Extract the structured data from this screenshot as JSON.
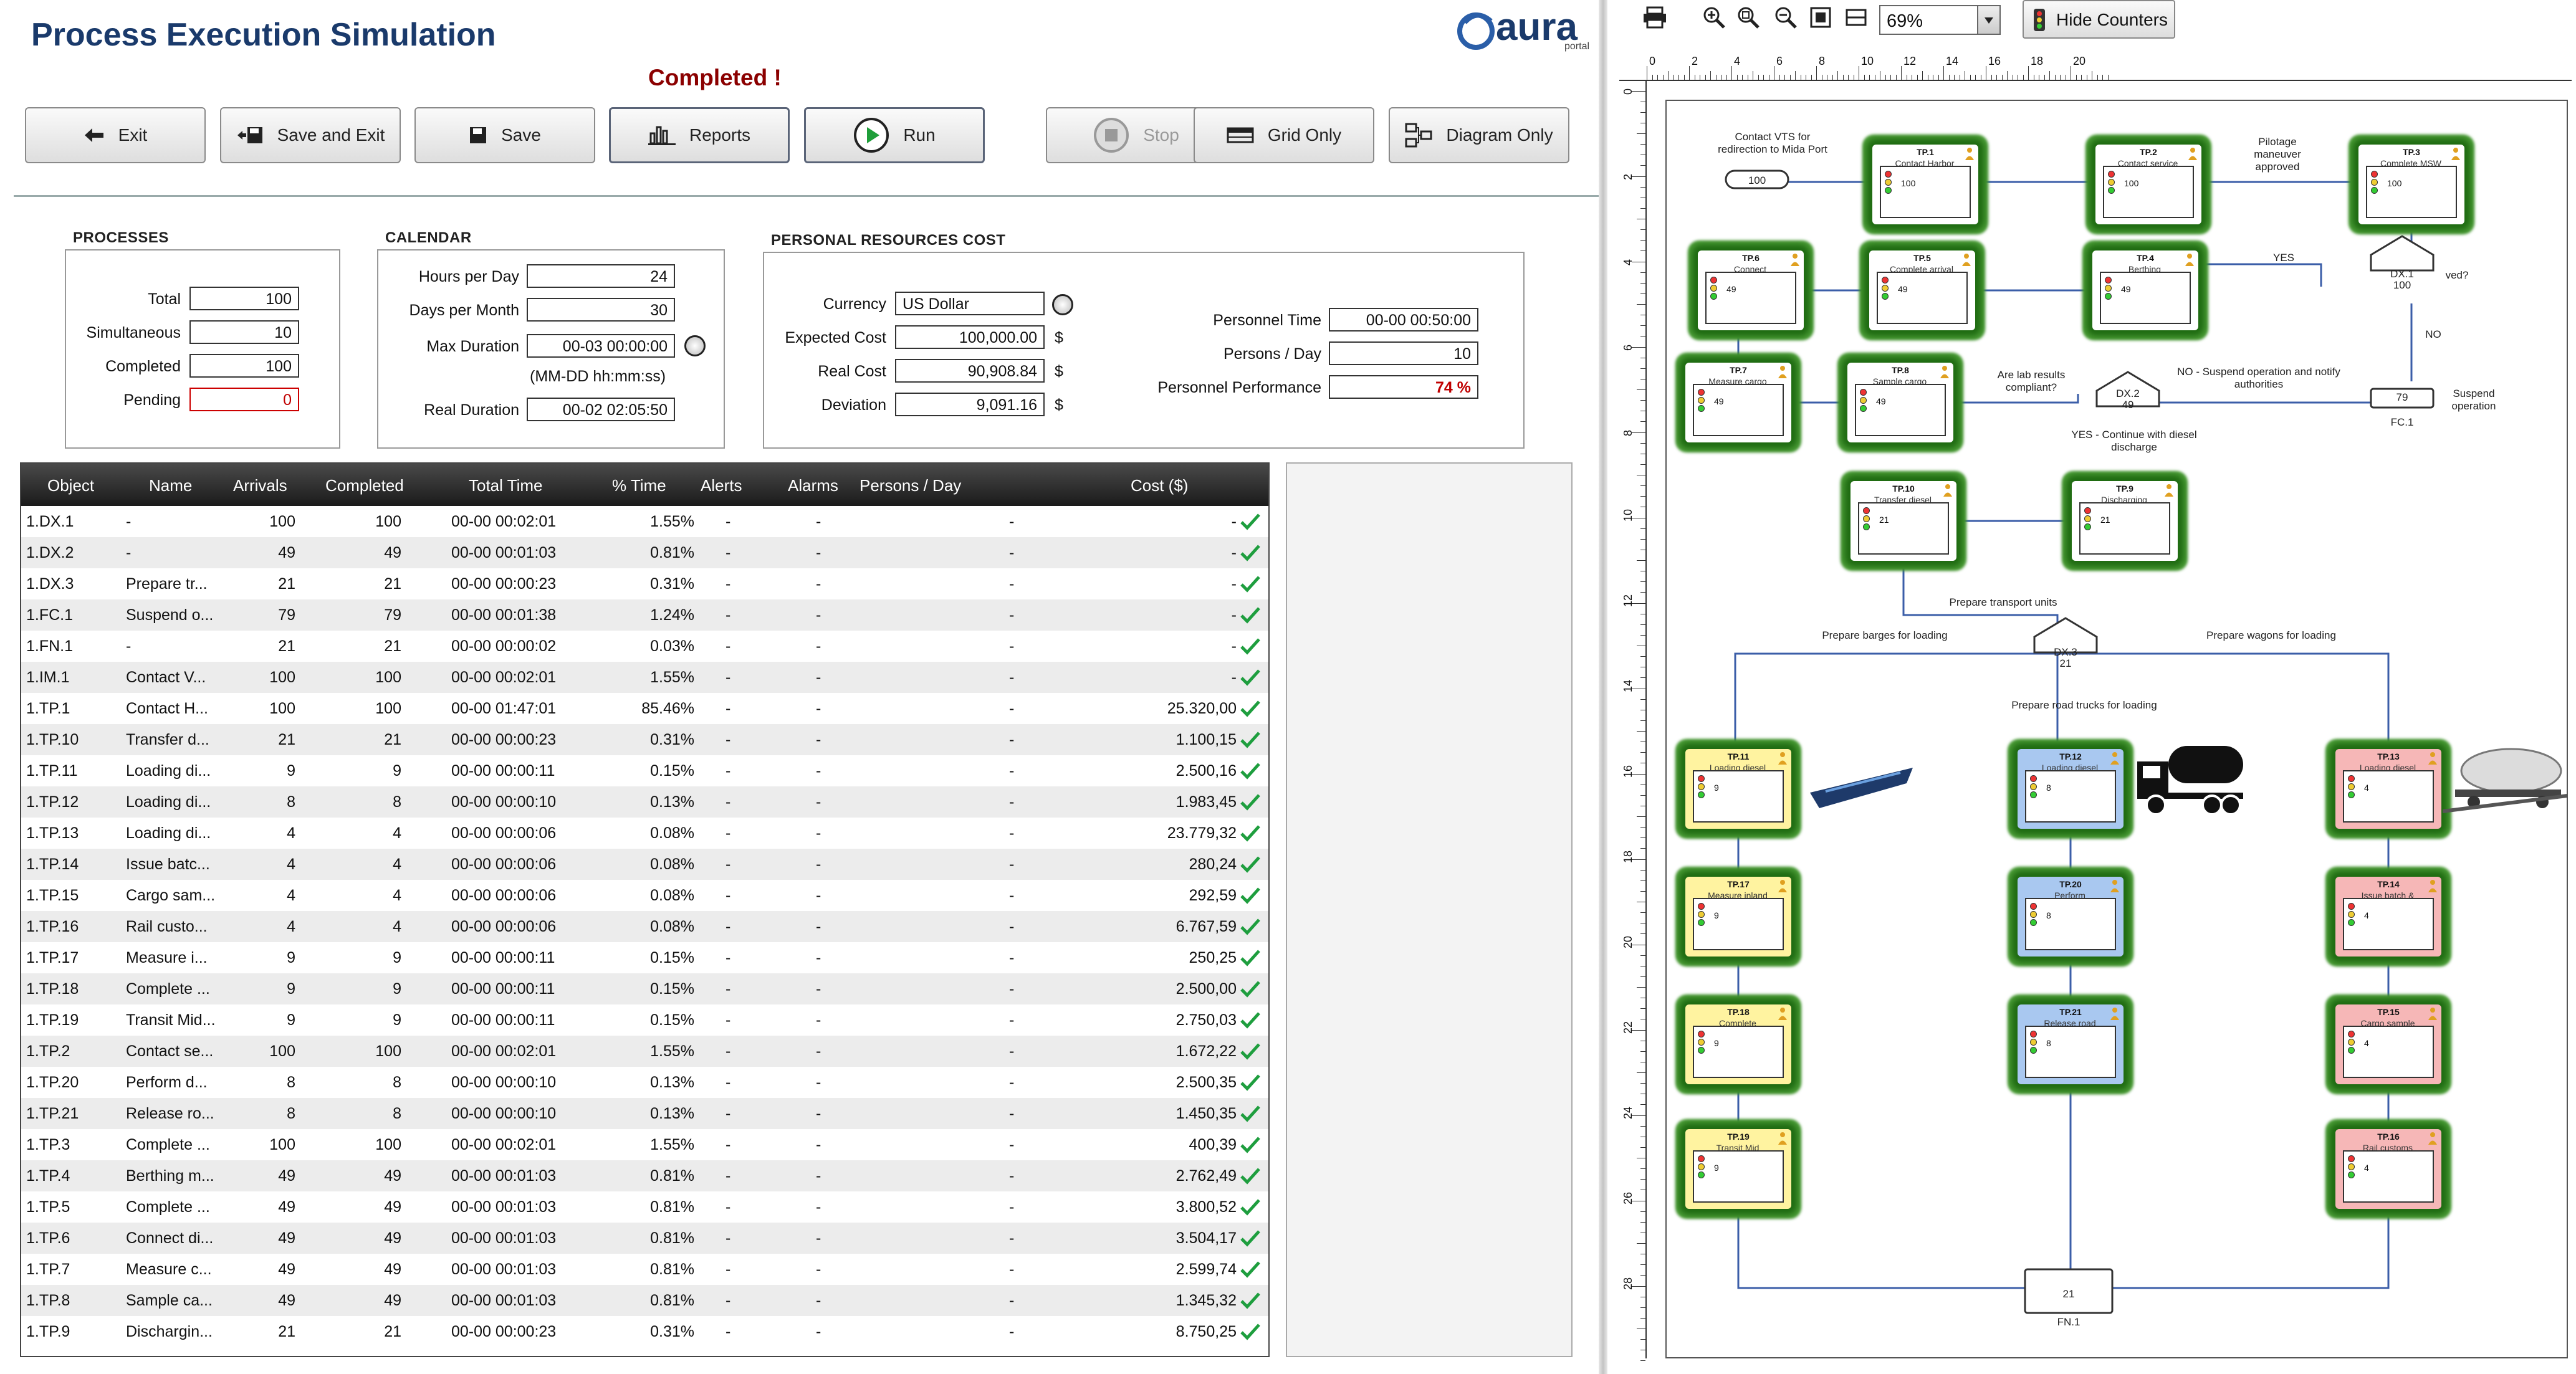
{
  "app": {
    "title": "Process Execution Simulation",
    "status": "Completed !",
    "logo": "aura",
    "logo_sub": "portal"
  },
  "toolbar": {
    "exit": "Exit",
    "save_exit": "Save and Exit",
    "save": "Save",
    "reports": "Reports",
    "run": "Run",
    "stop": "Stop",
    "grid_only": "Grid Only",
    "diagram_only": "Diagram Only"
  },
  "processes": {
    "title": "PROCESSES",
    "total_label": "Total",
    "total": "100",
    "simultaneous_label": "Simultaneous",
    "simultaneous": "10",
    "completed_label": "Completed",
    "completed": "100",
    "pending_label": "Pending",
    "pending": "0"
  },
  "calendar": {
    "title": "CALENDAR",
    "hours_label": "Hours per Day",
    "hours": "24",
    "days_label": "Days per Month",
    "days": "30",
    "max_label": "Max Duration",
    "max": "00-03 00:00:00",
    "format": "(MM-DD hh:mm:ss)",
    "real_label": "Real Duration",
    "real": "00-02 02:05:50"
  },
  "cost": {
    "title": "PERSONAL RESOURCES COST",
    "currency_label": "Currency",
    "currency": "US Dollar",
    "expected_label": "Expected Cost",
    "expected": "100,000.00",
    "real_label": "Real Cost",
    "real": "90,908.84",
    "deviation_label": "Deviation",
    "deviation": "9,091.16",
    "unit": "$",
    "ptime_label": "Personnel Time",
    "ptime": "00-00 00:50:00",
    "pday_label": "Persons / Day",
    "pday": "10",
    "perf_label": "Personnel Performance",
    "perf": "74 %"
  },
  "grid": {
    "headers": [
      "Object",
      "Name",
      "Arrivals",
      "Completed",
      "Total Time",
      "% Time",
      "Alerts",
      "Alarms",
      "Persons / Day",
      "Cost ($)"
    ],
    "rows": [
      [
        "1.DX.1",
        "-",
        "100",
        "100",
        "00-00 00:02:01",
        "1.55%",
        "-",
        "-",
        "-",
        "-"
      ],
      [
        "1.DX.2",
        "-",
        "49",
        "49",
        "00-00 00:01:03",
        "0.81%",
        "-",
        "-",
        "-",
        "-"
      ],
      [
        "1.DX.3",
        "Prepare tr...",
        "21",
        "21",
        "00-00 00:00:23",
        "0.31%",
        "-",
        "-",
        "-",
        "-"
      ],
      [
        "1.FC.1",
        "Suspend o...",
        "79",
        "79",
        "00-00 00:01:38",
        "1.24%",
        "-",
        "-",
        "-",
        "-"
      ],
      [
        "1.FN.1",
        "-",
        "21",
        "21",
        "00-00 00:00:02",
        "0.03%",
        "-",
        "-",
        "-",
        "-"
      ],
      [
        "1.IM.1",
        "Contact V...",
        "100",
        "100",
        "00-00 00:02:01",
        "1.55%",
        "-",
        "-",
        "-",
        "-"
      ],
      [
        "1.TP.1",
        "Contact H...",
        "100",
        "100",
        "00-00 01:47:01",
        "85.46%",
        "-",
        "-",
        "-",
        "25.320,00"
      ],
      [
        "1.TP.10",
        "Transfer d...",
        "21",
        "21",
        "00-00 00:00:23",
        "0.31%",
        "-",
        "-",
        "-",
        "1.100,15"
      ],
      [
        "1.TP.11",
        "Loading di...",
        "9",
        "9",
        "00-00 00:00:11",
        "0.15%",
        "-",
        "-",
        "-",
        "2.500,16"
      ],
      [
        "1.TP.12",
        "Loading di...",
        "8",
        "8",
        "00-00 00:00:10",
        "0.13%",
        "-",
        "-",
        "-",
        "1.983,45"
      ],
      [
        "1.TP.13",
        "Loading di...",
        "4",
        "4",
        "00-00 00:00:06",
        "0.08%",
        "-",
        "-",
        "-",
        "23.779,32"
      ],
      [
        "1.TP.14",
        "Issue batc...",
        "4",
        "4",
        "00-00 00:00:06",
        "0.08%",
        "-",
        "-",
        "-",
        "280,24"
      ],
      [
        "1.TP.15",
        "Cargo sam...",
        "4",
        "4",
        "00-00 00:00:06",
        "0.08%",
        "-",
        "-",
        "-",
        "292,59"
      ],
      [
        "1.TP.16",
        "Rail custo...",
        "4",
        "4",
        "00-00 00:00:06",
        "0.08%",
        "-",
        "-",
        "-",
        "6.767,59"
      ],
      [
        "1.TP.17",
        "Measure i...",
        "9",
        "9",
        "00-00 00:00:11",
        "0.15%",
        "-",
        "-",
        "-",
        "250,25"
      ],
      [
        "1.TP.18",
        "Complete ...",
        "9",
        "9",
        "00-00 00:00:11",
        "0.15%",
        "-",
        "-",
        "-",
        "2.500,00"
      ],
      [
        "1.TP.19",
        "Transit Mid...",
        "9",
        "9",
        "00-00 00:00:11",
        "0.15%",
        "-",
        "-",
        "-",
        "2.750,03"
      ],
      [
        "1.TP.2",
        "Contact se...",
        "100",
        "100",
        "00-00 00:02:01",
        "1.55%",
        "-",
        "-",
        "-",
        "1.672,22"
      ],
      [
        "1.TP.20",
        "Perform d...",
        "8",
        "8",
        "00-00 00:00:10",
        "0.13%",
        "-",
        "-",
        "-",
        "2.500,35"
      ],
      [
        "1.TP.21",
        "Release ro...",
        "8",
        "8",
        "00-00 00:00:10",
        "0.13%",
        "-",
        "-",
        "-",
        "1.450,35"
      ],
      [
        "1.TP.3",
        "Complete ...",
        "100",
        "100",
        "00-00 00:02:01",
        "1.55%",
        "-",
        "-",
        "-",
        "400,39"
      ],
      [
        "1.TP.4",
        "Berthing m...",
        "49",
        "49",
        "00-00 00:01:03",
        "0.81%",
        "-",
        "-",
        "-",
        "2.762,49"
      ],
      [
        "1.TP.5",
        "Complete ...",
        "49",
        "49",
        "00-00 00:01:03",
        "0.81%",
        "-",
        "-",
        "-",
        "3.800,52"
      ],
      [
        "1.TP.6",
        "Connect di...",
        "49",
        "49",
        "00-00 00:01:03",
        "0.81%",
        "-",
        "-",
        "-",
        "3.504,17"
      ],
      [
        "1.TP.7",
        "Measure c...",
        "49",
        "49",
        "00-00 00:01:03",
        "0.81%",
        "-",
        "-",
        "-",
        "2.599,74"
      ],
      [
        "1.TP.8",
        "Sample ca...",
        "49",
        "49",
        "00-00 00:01:03",
        "0.81%",
        "-",
        "-",
        "-",
        "1.345,32"
      ],
      [
        "1.TP.9",
        "Dischargin...",
        "21",
        "21",
        "00-00 00:00:23",
        "0.31%",
        "-",
        "-",
        "-",
        "8.750,25"
      ]
    ]
  },
  "diagram": {
    "zoom": "69%",
    "hide_counters": "Hide Counters",
    "ruler_top": [
      "0",
      "2",
      "4",
      "6",
      "8",
      "10",
      "12",
      "14",
      "16",
      "18",
      "20"
    ],
    "ruler_left": [
      "0",
      "2",
      "4",
      "6",
      "8",
      "10",
      "12",
      "14",
      "16",
      "18",
      "20",
      "22",
      "24",
      "26",
      "28"
    ],
    "nodes": [
      {
        "id": "TP.1",
        "name": "Contact Harbor",
        "count": "100",
        "color": "#ffffff"
      },
      {
        "id": "TP.2",
        "name": "Contact service",
        "count": "100",
        "color": "#ffffff"
      },
      {
        "id": "TP.3",
        "name": "Complete MSW",
        "count": "100",
        "color": "#ffffff"
      },
      {
        "id": "TP.6",
        "name": "Connect",
        "count": "49",
        "color": "#ffffff"
      },
      {
        "id": "TP.5",
        "name": "Complete arrival",
        "count": "49",
        "color": "#ffffff"
      },
      {
        "id": "TP.4",
        "name": "Berthing",
        "count": "49",
        "color": "#ffffff"
      },
      {
        "id": "TP.7",
        "name": "Measure cargo",
        "count": "49",
        "color": "#ffffff"
      },
      {
        "id": "TP.8",
        "name": "Sample cargo",
        "count": "49",
        "color": "#ffffff"
      },
      {
        "id": "TP.10",
        "name": "Transfer diesel",
        "count": "21",
        "color": "#ffffff"
      },
      {
        "id": "TP.9",
        "name": "Discharging",
        "count": "21",
        "color": "#ffffff"
      },
      {
        "id": "TP.11",
        "name": "Loading diesel",
        "count": "9",
        "color": "#fff3a0"
      },
      {
        "id": "TP.12",
        "name": "Loading diesel",
        "count": "8",
        "color": "#a9c8f0"
      },
      {
        "id": "TP.13",
        "name": "Loading diesel",
        "count": "4",
        "color": "#f6b7b7"
      },
      {
        "id": "TP.17",
        "name": "Measure inland",
        "count": "9",
        "color": "#fff3a0"
      },
      {
        "id": "TP.20",
        "name": "Perform",
        "count": "8",
        "color": "#a9c8f0"
      },
      {
        "id": "TP.14",
        "name": "Issue batch &",
        "count": "4",
        "color": "#f6b7b7"
      },
      {
        "id": "TP.18",
        "name": "Complete",
        "count": "9",
        "color": "#fff3a0"
      },
      {
        "id": "TP.21",
        "name": "Release road",
        "count": "8",
        "color": "#a9c8f0"
      },
      {
        "id": "TP.15",
        "name": "Cargo sample",
        "count": "4",
        "color": "#f6b7b7"
      },
      {
        "id": "TP.19",
        "name": "Transit Mid",
        "count": "9",
        "color": "#fff3a0"
      },
      {
        "id": "TP.16",
        "name": "Rail customs",
        "count": "4",
        "color": "#f6b7b7"
      }
    ],
    "labels": {
      "contact_vts": "Contact VTS for redirection to Mida Port",
      "im_count": "100",
      "pilotage": "Pilotage maneuver approved",
      "yes": "YES",
      "no": "NO",
      "dx1": "DX.1",
      "dx1_count": "100",
      "dx1_q": "ved?",
      "lab": "Are lab results compliant?",
      "dx2": "DX.2",
      "dx2_count": "49",
      "no_suspend": "NO - Suspend operation and notify authorities",
      "fc_count": "79",
      "fc1": "FC.1",
      "suspend": "Suspend operation",
      "yes_continue": "YES - Continue with diesel discharge",
      "prep_transport": "Prepare transport units",
      "dx3": "DX.3",
      "dx3_count": "21",
      "prep_barges": "Prepare barges for loading",
      "prep_wagons": "Prepare wagons for loading",
      "prep_road": "Prepare road trucks for loading",
      "fn_count": "21",
      "fn1": "FN.1"
    }
  }
}
